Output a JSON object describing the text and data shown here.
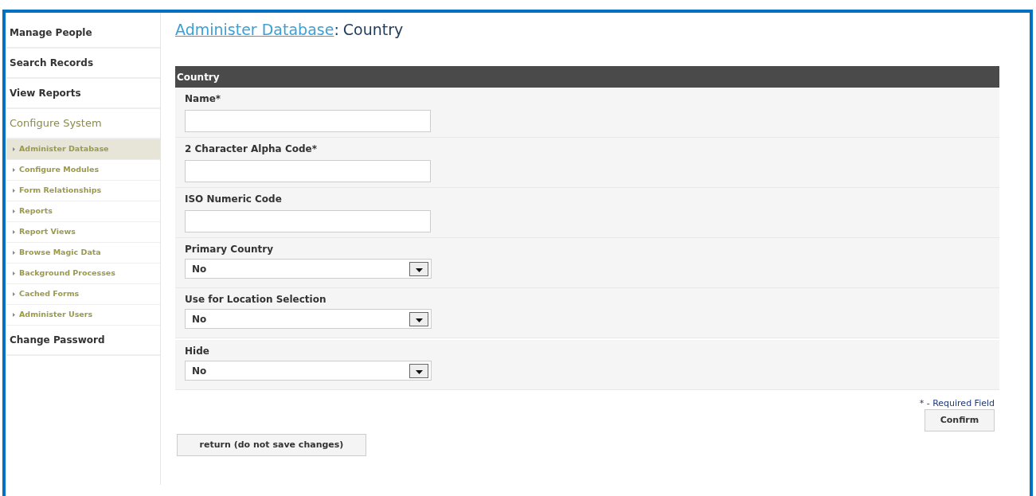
{
  "sidebar": {
    "items": [
      {
        "kind": "link",
        "label": "Manage People"
      },
      {
        "kind": "link",
        "label": "Search Records"
      },
      {
        "kind": "link",
        "label": "View Reports"
      },
      {
        "kind": "header",
        "label": "Configure System"
      },
      {
        "kind": "sub",
        "label": "Administer Database",
        "selected": true
      },
      {
        "kind": "sub",
        "label": "Configure Modules",
        "selected": false
      },
      {
        "kind": "sub",
        "label": "Form Relationships",
        "selected": false
      },
      {
        "kind": "sub",
        "label": "Reports",
        "selected": false
      },
      {
        "kind": "sub",
        "label": "Report Views",
        "selected": false
      },
      {
        "kind": "sub",
        "label": "Browse Magic Data",
        "selected": false
      },
      {
        "kind": "sub",
        "label": "Background Processes",
        "selected": false
      },
      {
        "kind": "sub",
        "label": "Cached Forms",
        "selected": false
      },
      {
        "kind": "sub",
        "label": "Administer Users",
        "selected": false
      },
      {
        "kind": "link",
        "label": "Change Password"
      }
    ]
  },
  "heading": {
    "link": "Administer Database",
    "separator": ":",
    "title": "Country"
  },
  "form": {
    "title": "Country",
    "fields": [
      {
        "kind": "text",
        "label": "Name*"
      },
      {
        "kind": "text",
        "label": "2 Character Alpha Code*"
      },
      {
        "kind": "text",
        "label": "ISO Numeric Code"
      },
      {
        "kind": "select",
        "label": "Primary Country",
        "value": "No"
      },
      {
        "kind": "select",
        "label": "Use for Location Selection",
        "value": "No"
      },
      {
        "kind": "select",
        "label": "Hide",
        "value": "No"
      }
    ]
  },
  "required_note": "* - Required Field",
  "confirm_button": "Confirm",
  "return_button": "return (do not save changes)"
}
